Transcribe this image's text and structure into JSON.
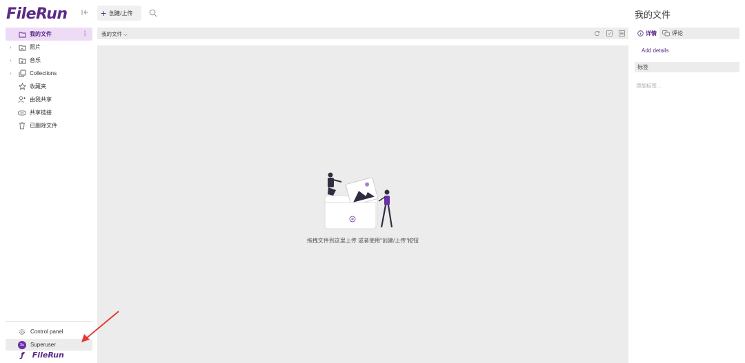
{
  "app": {
    "logo": "FileRun"
  },
  "toolbar": {
    "create_label": "创建/上传"
  },
  "sidebar": {
    "items": [
      {
        "label": "我的文件",
        "icon": "folder-icon",
        "active": true
      },
      {
        "label": "照片",
        "icon": "photo-folder-icon"
      },
      {
        "label": "音乐",
        "icon": "music-folder-icon"
      },
      {
        "label": "Collections",
        "icon": "collections-icon"
      },
      {
        "label": "收藏夹",
        "icon": "star-icon"
      },
      {
        "label": "由我共享",
        "icon": "share-user-icon"
      },
      {
        "label": "共享链接",
        "icon": "link-icon"
      },
      {
        "label": "已删除文件",
        "icon": "trash-icon"
      }
    ],
    "bottom": {
      "control_panel": "Control panel",
      "user": "Superuser",
      "avatar_initials": "Su",
      "footer_logo": "FileRun"
    }
  },
  "main": {
    "breadcrumb": "我的文件 ⌵",
    "empty_message": "拖拽文件到这里上传 或者使用\"创建/上传\"按钮"
  },
  "details_panel": {
    "title": "我的文件",
    "tabs": [
      {
        "label": "详情",
        "active": true
      },
      {
        "label": "评论"
      }
    ],
    "add_details": "Add details",
    "tags_heading": "标签",
    "tags_placeholder": "添加标签..."
  },
  "colors": {
    "accent": "#5b2a86",
    "active_bg": "#eedcf7",
    "panel_bg": "#ececec",
    "annotation": "#e53935"
  }
}
